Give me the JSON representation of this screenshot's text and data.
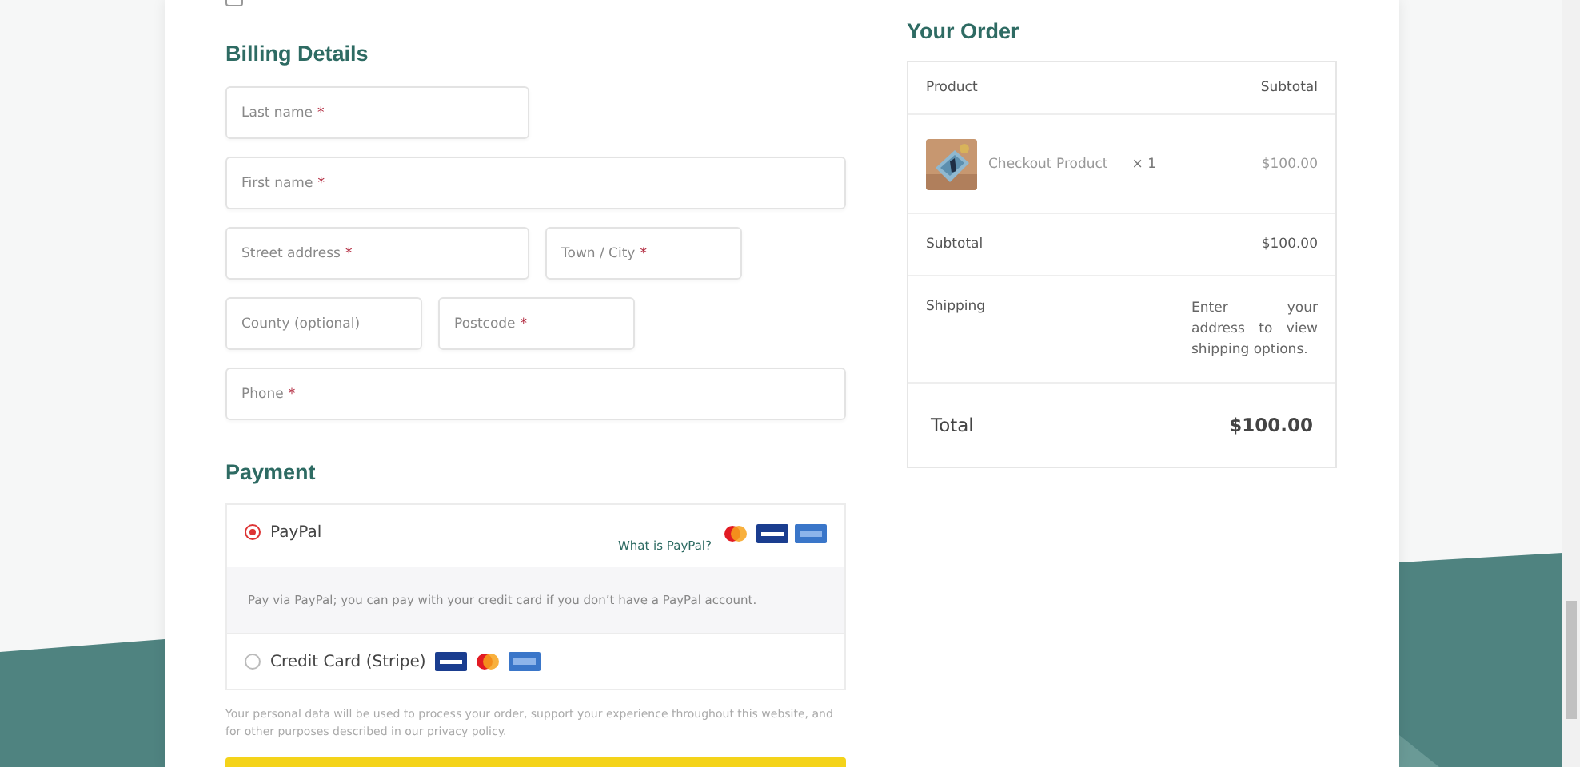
{
  "account_checkbox": {
    "checked": false
  },
  "billing": {
    "title": "Billing Details",
    "rows": [
      [
        {
          "placeholder": "Last name",
          "required_mark": "*",
          "kind": "half"
        }
      ],
      [
        {
          "placeholder": "First name",
          "required_mark": "*",
          "kind": "full"
        }
      ],
      [
        {
          "placeholder": "Street address",
          "required_mark": "*",
          "kind": "half"
        },
        {
          "placeholder": "Town / City",
          "required_mark": "*",
          "kind": "third"
        }
      ],
      [
        {
          "placeholder": "County (optional)",
          "kind": "third"
        },
        {
          "placeholder": "Postcode",
          "required_mark": "*",
          "kind": "third"
        }
      ],
      [
        {
          "placeholder": "Phone",
          "required_mark": "*",
          "kind": "full"
        }
      ]
    ]
  },
  "payment": {
    "title": "Payment",
    "methods": [
      {
        "label": "PayPal",
        "selected": true,
        "link": "What is PayPal?",
        "description": "Pay via PayPal; you can pay with your credit card if you don’t have a PayPal account."
      },
      {
        "label": "Credit Card (Stripe)",
        "selected": false
      }
    ],
    "privacy_note": "Your personal data will be used to process your order, support your experience throughout this website, and for other purposes described in our privacy policy."
  },
  "order": {
    "title": "Your Order",
    "header": {
      "product": "Product",
      "subtotal": "Subtotal"
    },
    "items": [
      {
        "kind": "picture",
        "name": "Checkout Product",
        "quantity": "× 1",
        "price": "$100.00"
      }
    ],
    "subtotal": {
      "label": "Subtotal",
      "value": "$100.00"
    },
    "shipping": {
      "label": "Shipping",
      "note": "Enter your address to view shipping options."
    },
    "total": {
      "label": "Total",
      "value": "$100.00"
    }
  }
}
